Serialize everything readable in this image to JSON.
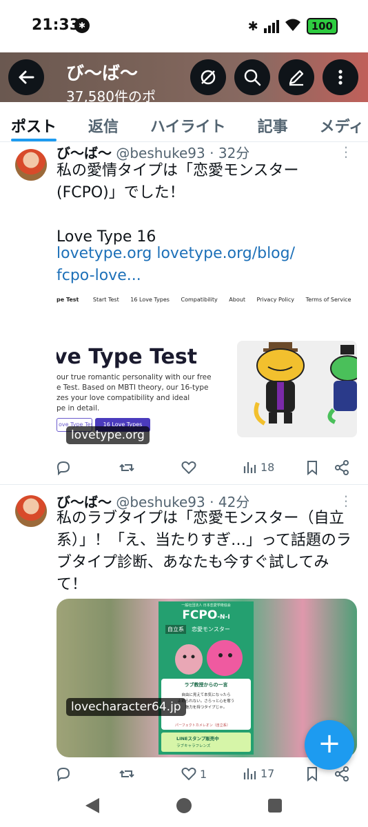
{
  "status_bar": {
    "time": "21:33",
    "battery": "100"
  },
  "header": {
    "title": "び〜ば〜",
    "subtitle": "37,580件のポ"
  },
  "tabs": [
    "ポスト",
    "返信",
    "ハイライト",
    "記事",
    "メディ"
  ],
  "tweets": [
    {
      "name": "び〜ば〜",
      "handle": "@beshuke93",
      "time": "32分",
      "text": "私の愛情タイプは「恋愛モンスター(FCPO)」でした！\n\nLove Type 16",
      "links": "lovetype.org lovetype.org/blog/\nfcpo-love...",
      "card": {
        "domain": "lovetype.org",
        "nav": [
          "pe Test",
          "Start Test",
          "16 Love Types",
          "Compatibility",
          "About",
          "Privacy Policy",
          "Terms of Service"
        ],
        "headline": "ve Type Test",
        "body": "our true romantic personality with our free\ne Test. Based on MBTI theory, our 16-type\nzes your love compatibility and ideal\npe in detail.",
        "btn1": "ove Type Test",
        "btn2": "16 Love Types"
      },
      "views": "18",
      "likes": ""
    },
    {
      "name": "び〜ば〜",
      "handle": "@beshuke93",
      "time": "42分",
      "text": "私のラブタイプは「恋愛モンスター（自立系）」！「え、当たりすぎ…」って話題のラブタイプ診断、あなたも今すぐ試してみて！",
      "card": {
        "domain": "lovecharacter64.jp",
        "poster_title": "FCPO",
        "poster_code": "-N-I",
        "poster_sub1": "自立系",
        "poster_sub2": "恋愛モンスター",
        "poster_quote_title": "ラブ教授からの一言",
        "poster_quote": "自由に見えて本気になったら\n止められない。さらっと心を奪う\n魅力を持つタイプじゃ。",
        "poster_match": "パーフェクトカメレオン（自立系）",
        "poster_stamp": "LINEスタンプ販売中",
        "poster_stamp_sub": "ラブキャラフレンズ",
        "poster_header": "一般社団法人 日本恋愛学術協会"
      },
      "views": "17",
      "likes": "1"
    }
  ],
  "colors": {
    "accent": "#1d9bf0",
    "link": "#1d70b8",
    "muted": "#536471"
  },
  "icons": [
    "back-arrow-icon",
    "notifications-off-icon",
    "search-icon",
    "compose-icon",
    "more-vertical-icon",
    "reply-icon",
    "repost-icon",
    "like-icon",
    "views-icon",
    "bookmark-icon",
    "share-icon",
    "plus-icon"
  ]
}
